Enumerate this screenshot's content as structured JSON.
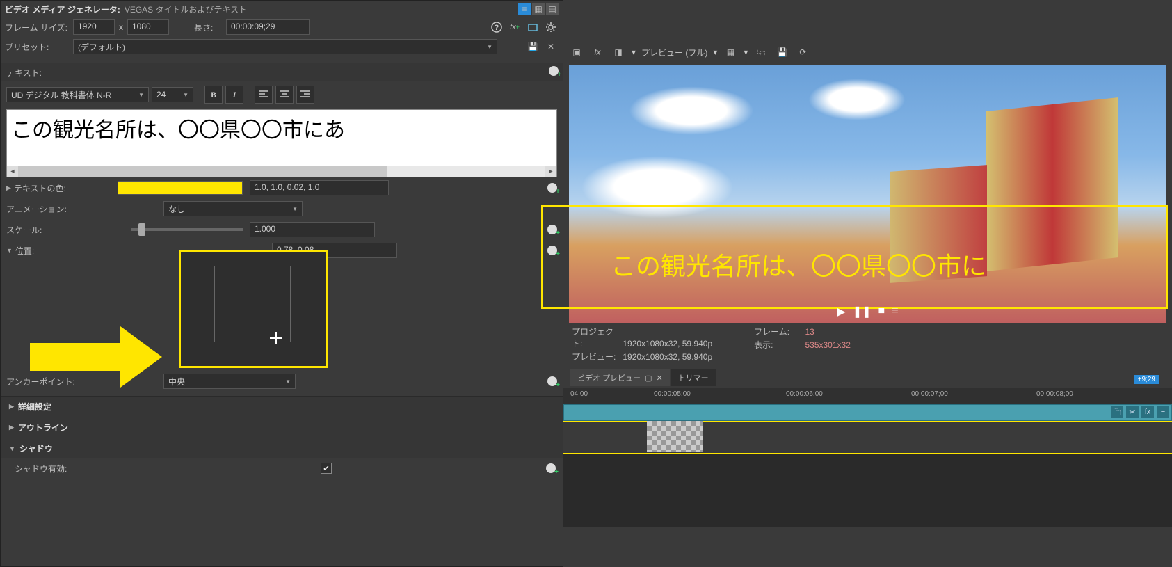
{
  "generator": {
    "title_label": "ビデオ メディア ジェネレータ:",
    "title_value": "VEGAS タイトルおよびテキスト",
    "frame_size_label": "フレーム サイズ:",
    "frame_w": "1920",
    "frame_x": "x",
    "frame_h": "1080",
    "length_label": "長さ:",
    "length_value": "00:00:09;29",
    "preset_label": "プリセット:",
    "preset_value": "(デフォルト)"
  },
  "text_section": {
    "header": "テキスト:",
    "font": "UD デジタル 教科書体 N-R",
    "size": "24",
    "content": "この観光名所は、〇〇県〇〇市にあ"
  },
  "props": {
    "text_color_label": "テキストの色:",
    "text_color_hex": "#ffe600",
    "text_color_vals": "1.0, 1.0, 0.02, 1.0",
    "animation_label": "アニメーション:",
    "animation_val": "なし",
    "scale_label": "スケール:",
    "scale_val": "1.000",
    "position_label": "位置:",
    "position_val": "0.78, 0.08",
    "anchor_label": "アンカーポイント:",
    "anchor_val": "中央",
    "advanced_label": "詳細設定",
    "outline_label": "アウトライン",
    "shadow_label": "シャドウ",
    "shadow_enable_label": "シャドウ有効:"
  },
  "preview": {
    "dropdown_label": "プレビュー (フル)",
    "overlay_text": "この観光名所は、〇〇県〇〇市に",
    "project_label": "プロジェクト:",
    "project_val": "1920x1080x32, 59.940p",
    "preview_label": "プレビュー:",
    "preview_val": "1920x1080x32, 59.940p",
    "frame_label": "フレーム:",
    "frame_val": "13",
    "display_label": "表示:",
    "display_val": "535x301x32",
    "tab_preview": "ビデオ プレビュー",
    "tab_trimmer": "トリマー"
  },
  "timeline": {
    "inout": "+9;29",
    "ticks": [
      "04;00",
      "00:00:05;00",
      "00:00:06;00",
      "00:00:07;00",
      "00:00:08;00"
    ]
  }
}
